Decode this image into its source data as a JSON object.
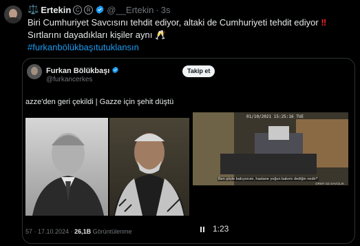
{
  "header": {
    "display_name": "Ertekin",
    "name_prefix": "⚖️",
    "badge_c": "C",
    "badge_r": "R",
    "handle": "@__Ertekin",
    "separator": "·",
    "time": "3s"
  },
  "tweet": {
    "line1": "Biri Cumhuriyet Savcısını tehdit ediyor, altaki de Cumhuriyeti tehdit ediyor",
    "line1_emoji": "‼",
    "line2": "Sırtlarını dayadıkları kişiler aynı",
    "line2_emoji": "🥂",
    "hashtag": "#furkanbölükbaşıtutuklansın"
  },
  "quote": {
    "name": "Furkan Bölükbaşı",
    "handle": "@furkancerkes",
    "follow_label": "Takip et",
    "text": "azze'den geri çekildi | Gazze için şehit düştü",
    "meta_prefix": "57 · 17.10.2024 · ",
    "views": "26,1B",
    "views_suffix": " Görüntülenme",
    "duration": "1:23",
    "video": {
      "timestamp": "01/10/2021  15:25:16  TUE",
      "subtitle": "Ben şöyle bakıyorum, hastane yoğun bakımı dediğin nedir?",
      "watermark": "DRMT OZ SAVCILIK"
    }
  },
  "colors": {
    "background": "#000000",
    "text": "#e7e9ea",
    "muted": "#71767b",
    "accent": "#1d9bf0",
    "verified": "#1d9bf0"
  },
  "icons": {
    "verified": "verified-badge-icon",
    "pause": "pause-icon"
  }
}
